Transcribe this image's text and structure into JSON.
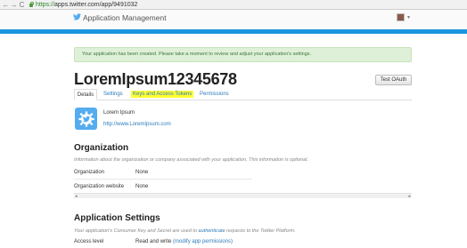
{
  "browser": {
    "back_icon": "←",
    "forward_icon": "→",
    "reload_icon": "C",
    "url_scheme": "https://",
    "url_rest": "apps.twitter.com/app/9491032"
  },
  "header": {
    "title": "Application Management"
  },
  "alert": {
    "text": "Your application has been created. Please take a moment to review and adjust your application's settings."
  },
  "app": {
    "name": "LoremIpsum12345678",
    "test_oauth_label": "Test OAuth",
    "description": "Lorem Ipsum",
    "url": "http://www.LoremIpsum.com"
  },
  "tabs": [
    {
      "label": "Details"
    },
    {
      "label": "Settings"
    },
    {
      "label": "Keys and Access Tokens"
    },
    {
      "label": "Permissions"
    }
  ],
  "organization": {
    "heading": "Organization",
    "info": "Information about the organization or company associated with your application. This information is optional.",
    "rows": [
      {
        "label": "Organization",
        "value": "None"
      },
      {
        "label": "Organization website",
        "value": "None"
      }
    ]
  },
  "application_settings": {
    "heading": "Application Settings",
    "info_before": "Your application's Consumer Key and Secret are used to ",
    "info_link": "authenticate",
    "info_after": " requests to the Twitter Platform.",
    "access_level_label": "Access level",
    "access_level_value": "Read and write",
    "access_level_link": "(modify app permissions)"
  },
  "scrollbar": {
    "left_arrow": "◂",
    "right_arrow": "▸"
  },
  "colors": {
    "twitter_blue": "#1b95e0",
    "alert_bg": "#dff0d8",
    "highlight": "#ffff33",
    "link": "#2b7bb9"
  }
}
